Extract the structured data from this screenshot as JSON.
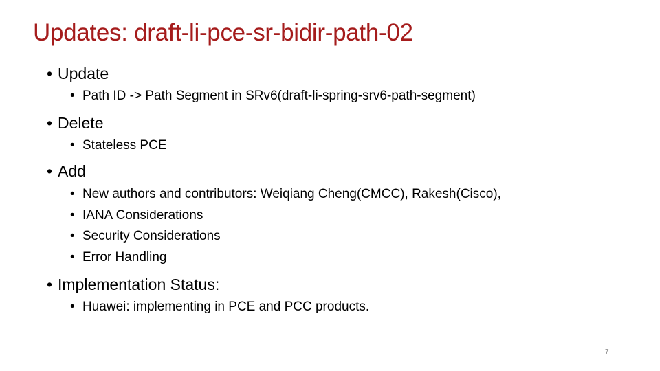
{
  "slide": {
    "title": "Updates: draft-li-pce-sr-bidir-path-02",
    "bullet_glyph": "•",
    "sections": [
      {
        "heading": "Update",
        "items": [
          "Path ID -> Path Segment in SRv6(draft-li-spring-srv6-path-segment)"
        ]
      },
      {
        "heading": "Delete",
        "items": [
          "Stateless PCE"
        ]
      },
      {
        "heading": "Add",
        "items": [
          "New authors and contributors: Weiqiang Cheng(CMCC), Rakesh(Cisco),",
          "IANA Considerations",
          "Security Considerations",
          "Error Handling"
        ]
      },
      {
        "heading": "Implementation Status:",
        "items": [
          "Huawei: implementing in PCE and PCC products."
        ]
      }
    ],
    "page_number": "7"
  },
  "colors": {
    "title": "#a51c1c",
    "body": "#000000",
    "page_number": "#7f7f7f"
  }
}
